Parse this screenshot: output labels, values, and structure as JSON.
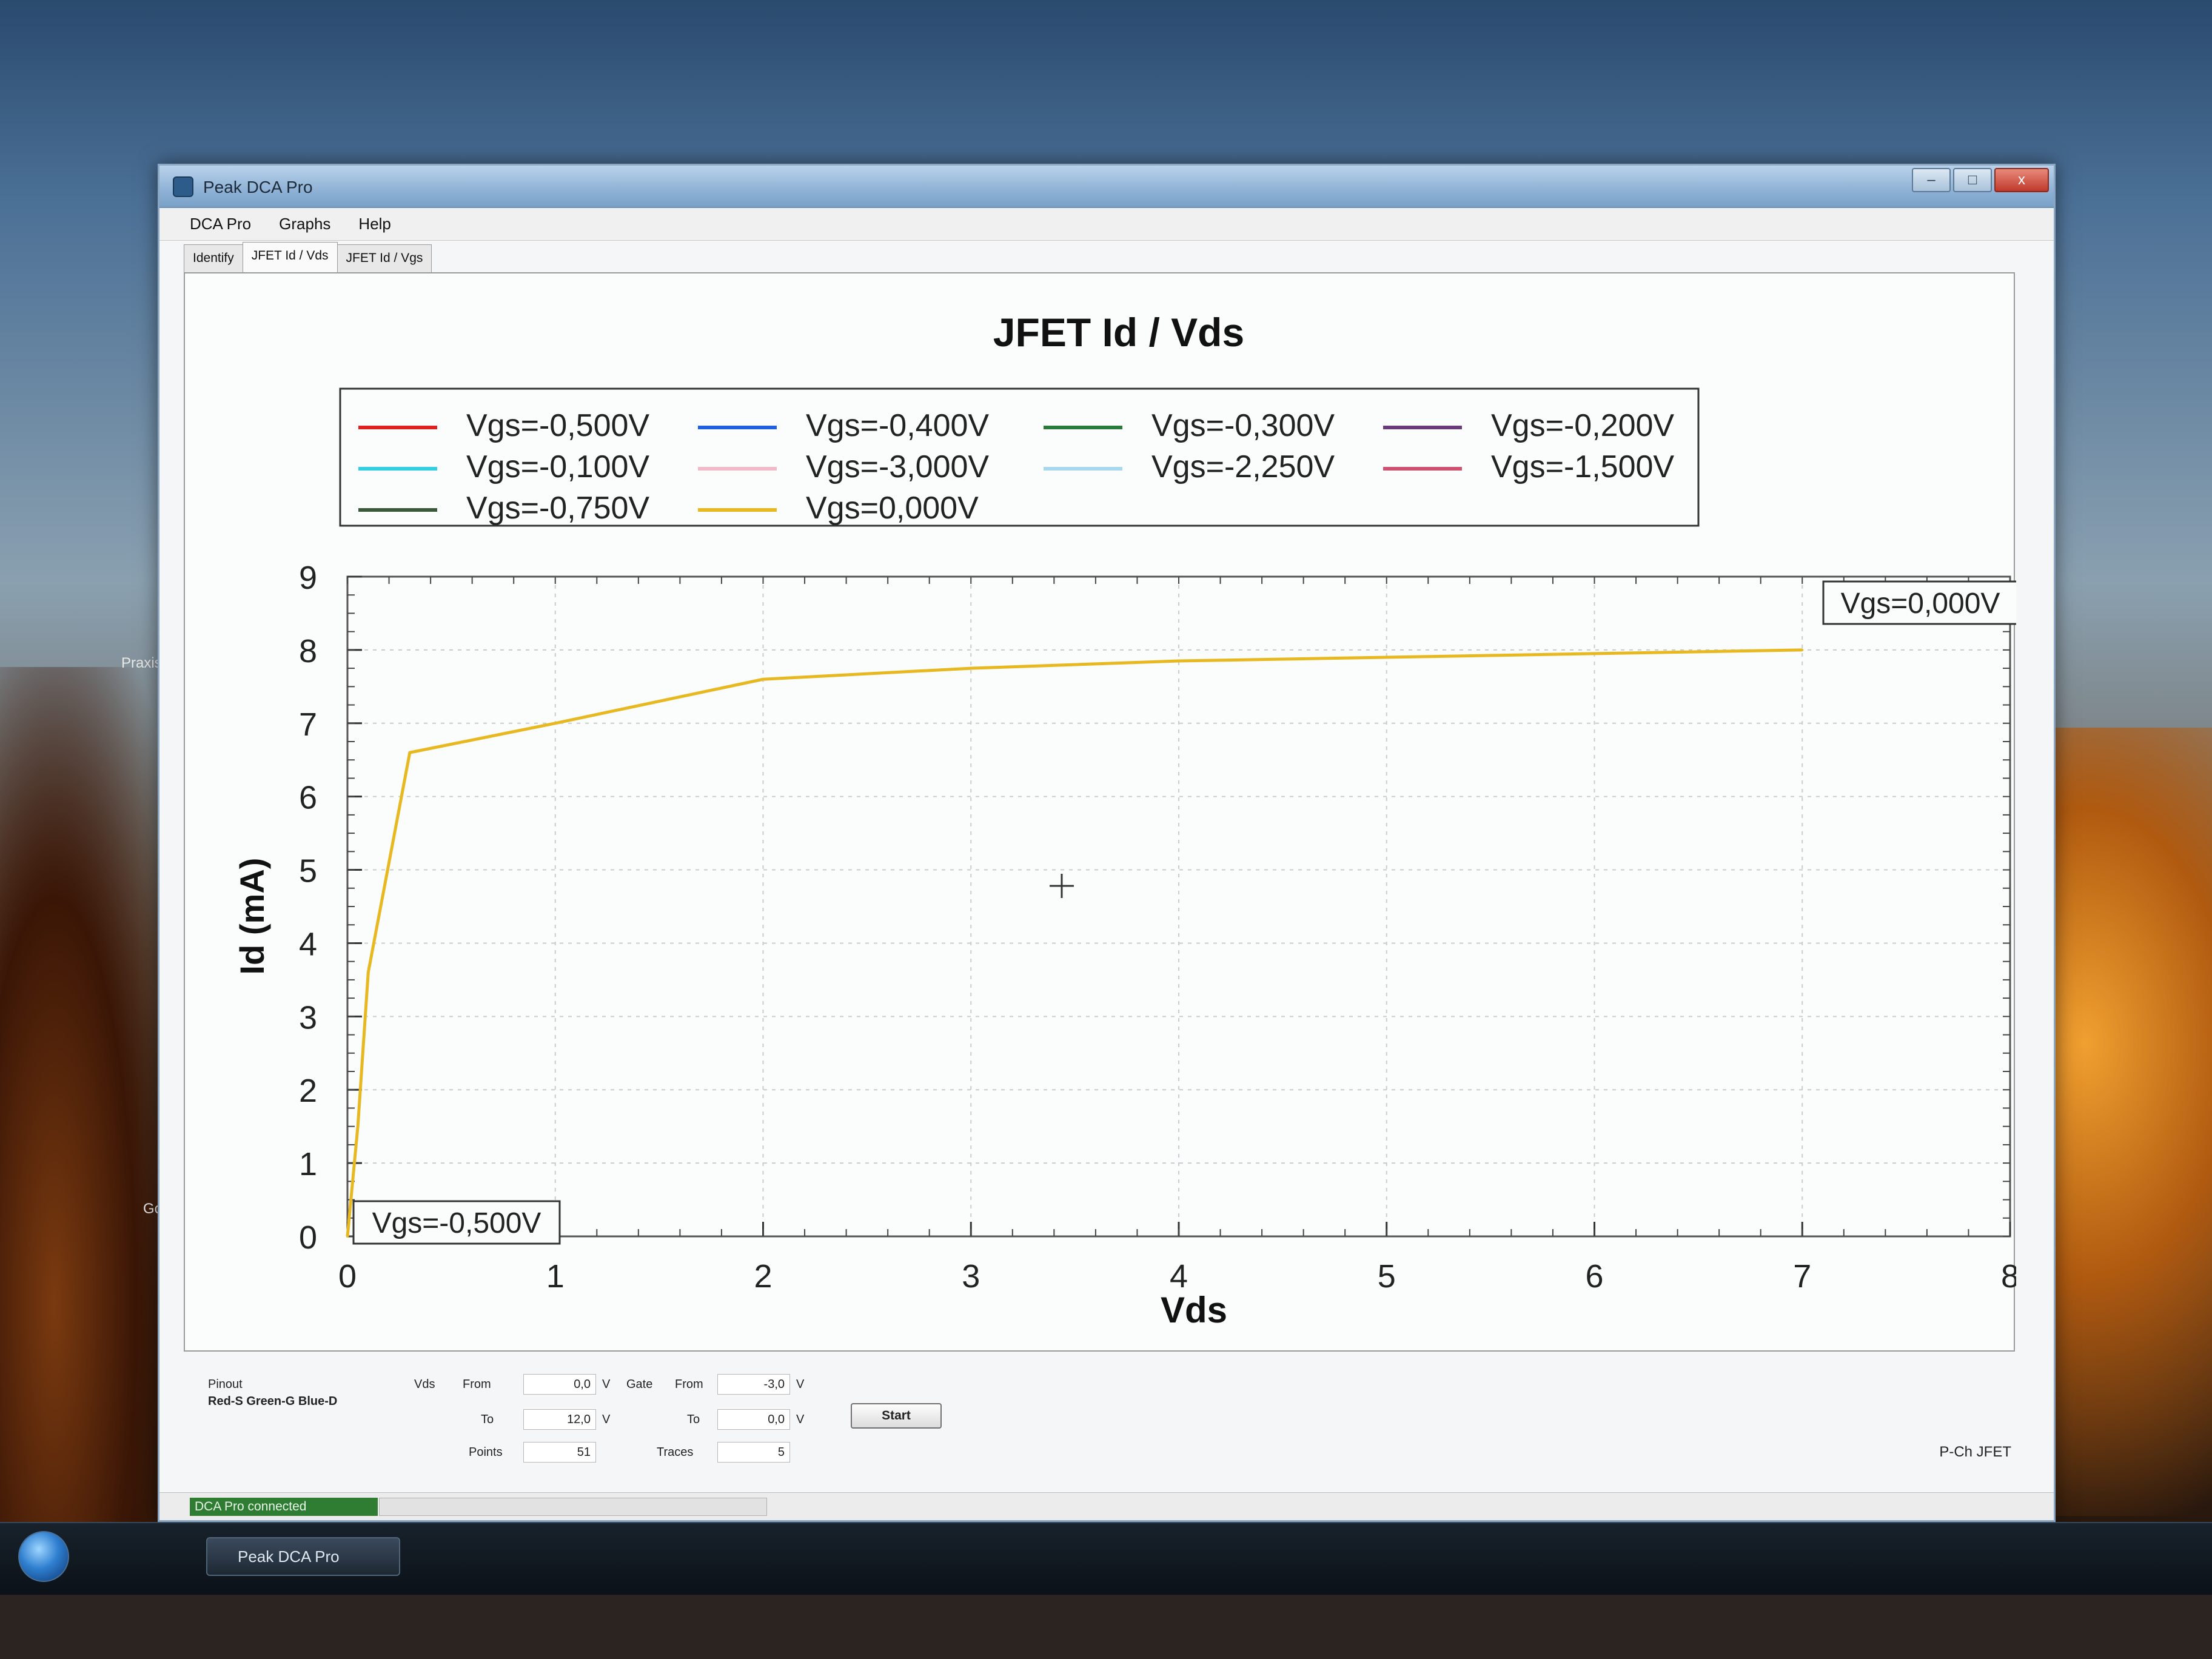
{
  "window": {
    "title": "Peak DCA Pro",
    "controls": {
      "minimize": "–",
      "maximize": "□",
      "close": "x"
    }
  },
  "menu": [
    "DCA Pro",
    "Graphs",
    "Help"
  ],
  "tabs": [
    "Identify",
    "JFET Id / Vds",
    "JFET Id / Vgs"
  ],
  "chart_data": {
    "type": "line",
    "title": "JFET Id / Vds",
    "xlabel": "Vds",
    "ylabel": "Id (mA)",
    "xlim": [
      0,
      8
    ],
    "ylim": [
      0,
      9
    ],
    "xticks": [
      "0",
      "1",
      "2",
      "3",
      "4",
      "5",
      "6",
      "7",
      "8"
    ],
    "yticks": [
      "0",
      "1",
      "2",
      "3",
      "4",
      "5",
      "6",
      "7",
      "8",
      "9"
    ],
    "grid": true,
    "legend": [
      {
        "name": "Vgs=-0,500V",
        "color": "#e02020"
      },
      {
        "name": "Vgs=-0,400V",
        "color": "#2060e0"
      },
      {
        "name": "Vgs=-0,300V",
        "color": "#2a7a3a"
      },
      {
        "name": "Vgs=-0,200V",
        "color": "#6a3a7a"
      },
      {
        "name": "Vgs=-0,100V",
        "color": "#30d0e0"
      },
      {
        "name": "Vgs=-3,000V",
        "color": "#f0b8c8"
      },
      {
        "name": "Vgs=-2,250V",
        "color": "#a8d8f0"
      },
      {
        "name": "Vgs=-1,500V",
        "color": "#d05070"
      },
      {
        "name": "Vgs=-0,750V",
        "color": "#3a5a3a"
      },
      {
        "name": "Vgs=0,000V",
        "color": "#e8b820"
      }
    ],
    "series": [
      {
        "name": "Vgs=0,000V",
        "color": "#e8b820",
        "x": [
          0,
          0.05,
          0.1,
          0.3,
          1.0,
          2.0,
          3.0,
          4.0,
          5.0,
          6.0,
          7.0
        ],
        "y": [
          0,
          1.5,
          3.6,
          6.6,
          7.0,
          7.6,
          7.75,
          7.85,
          7.9,
          7.95,
          8.0
        ]
      }
    ],
    "annotations": [
      "Vgs=0,000V",
      "Vgs=-0,500V"
    ]
  },
  "controls": {
    "pinout_label": "Pinout",
    "pinout_value": "Red-S Green-G Blue-D",
    "vds_label": "Vds",
    "gate_label": "Gate",
    "from_label": "From",
    "to_label": "To",
    "points_label": "Points",
    "traces_label": "Traces",
    "vds_from": "0,0",
    "vds_to": "12,0",
    "gate_from": "-3,0",
    "gate_to": "0,0",
    "points": "51",
    "traces": "5",
    "unit_v": "V",
    "start": "Start",
    "device_type": "P-Ch JFET"
  },
  "status": {
    "connection": "DCA Pro connected"
  },
  "taskbar": {
    "task": "Peak DCA Pro"
  },
  "desktop": {
    "icon_praxis": "Praxis",
    "icon_google": "Google"
  }
}
